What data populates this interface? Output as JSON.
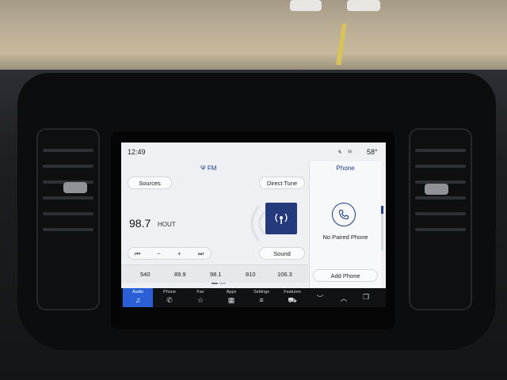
{
  "status": {
    "time": "12:49",
    "temperature": "58°",
    "icons": [
      "mute-icon",
      "wifi-icon"
    ]
  },
  "radio": {
    "band_label": "FM",
    "sources_label": "Sources",
    "direct_tune_label": "Direct Tune",
    "frequency": "98.7",
    "callsign": "HOUT",
    "sound_label": "Sound",
    "tune_controls": {
      "seek_back": "⏮",
      "minus": "−",
      "plus": "+",
      "seek_forward": "⏭"
    },
    "presets": [
      "540",
      "89.9",
      "98.1",
      "810",
      "106.3"
    ]
  },
  "phone": {
    "title": "Phone",
    "status": "No Paired Phone",
    "add_label": "Add Phone"
  },
  "nav": [
    {
      "label": "Audio",
      "icon": "♫",
      "active": true
    },
    {
      "label": "Phone",
      "icon": "✆"
    },
    {
      "label": "Fav",
      "icon": "☆"
    },
    {
      "label": "Apps",
      "icon": "▦"
    },
    {
      "label": "Settings",
      "icon": "≡"
    },
    {
      "label": "Features",
      "icon": "⛟"
    }
  ],
  "nav_extra_icons": [
    "︶",
    "︿",
    "❐"
  ],
  "colors": {
    "accent": "#1c3a8a",
    "nav_active": "#2a5fd8",
    "album_art": "#25397d"
  }
}
